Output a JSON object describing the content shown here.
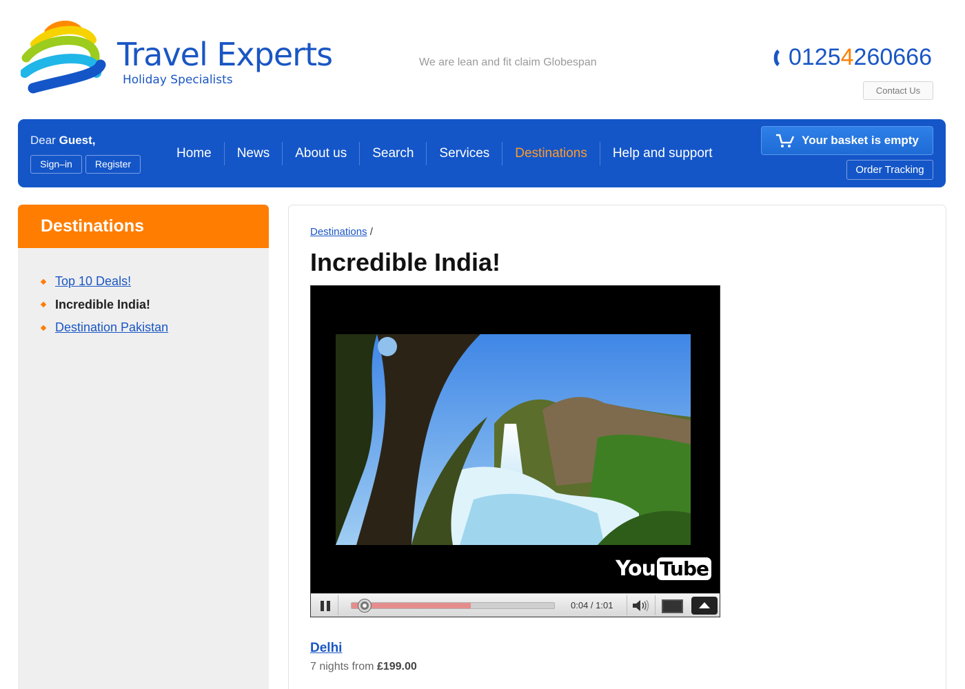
{
  "header": {
    "brand_title": "Travel Experts",
    "brand_subtitle": "Holiday Specialists",
    "tagline": "We are lean and fit claim Globespan",
    "phone_prefix": "0125",
    "phone_highlight": "4",
    "phone_suffix": " 260666",
    "contact_label": "Contact Us",
    "logo_icon": "rainbow-stripes-logo",
    "phone_icon": "phone-handset-icon"
  },
  "nav": {
    "greeting_prefix": "Dear",
    "greeting_name": "Guest,",
    "signin_label": "Sign–in",
    "register_label": "Register",
    "items": [
      {
        "label": "Home",
        "active": false
      },
      {
        "label": "News",
        "active": false
      },
      {
        "label": "About us",
        "active": false
      },
      {
        "label": "Search",
        "active": false
      },
      {
        "label": "Services",
        "active": false
      },
      {
        "label": "Destinations",
        "active": true
      },
      {
        "label": "Help and support",
        "active": false
      }
    ],
    "basket_label": "Your basket is empty",
    "basket_icon": "shopping-cart-icon",
    "order_tracking_label": "Order Tracking"
  },
  "sidebar": {
    "title": "Destinations",
    "items": [
      {
        "label": "Top 10 Deals!",
        "current": false
      },
      {
        "label": "Incredible India!",
        "current": true
      },
      {
        "label": "Destination Pakistan",
        "current": false
      }
    ]
  },
  "main": {
    "breadcrumb": "Destinations",
    "breadcrumb_separator": "/",
    "title": "Incredible India!",
    "video": {
      "brand_you": "You",
      "brand_tube": "Tube",
      "time": "0:04 / 1:01",
      "progress_played": 0.01,
      "progress_loaded": 0.59
    },
    "destination_name": "Delhi",
    "destination_desc_prefix": "7 nights from",
    "destination_price": "£199.00"
  },
  "colors": {
    "brand_blue": "#1456c8",
    "accent_orange": "#ff7d00",
    "link_blue": "#1a56c4",
    "sidebar_bg": "#efefef"
  }
}
